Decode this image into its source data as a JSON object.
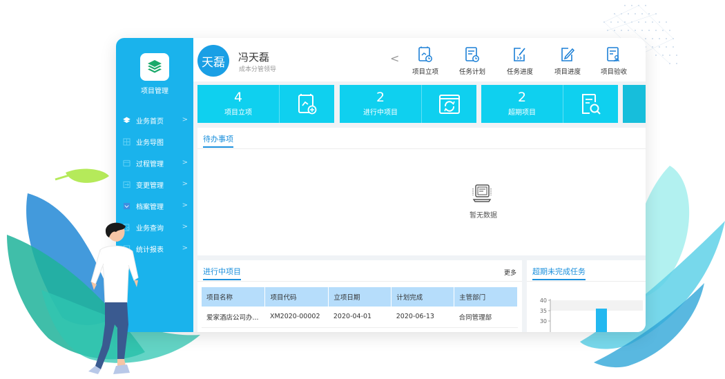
{
  "sidebar": {
    "title": "项目管理",
    "items": [
      {
        "label": "业务首页",
        "icon": "layers-icon"
      },
      {
        "label": "业务导图",
        "icon": "map-icon"
      },
      {
        "label": "过程管理",
        "icon": "process-icon"
      },
      {
        "label": "变更管理",
        "icon": "change-icon"
      },
      {
        "label": "档案管理",
        "icon": "archive-icon"
      },
      {
        "label": "业务查询",
        "icon": "query-icon"
      },
      {
        "label": "统计报表",
        "icon": "report-icon"
      }
    ]
  },
  "user": {
    "avatar_text": "天磊",
    "name": "冯天磊",
    "role": "成本分管领导"
  },
  "quick_actions": [
    {
      "label": "项目立项",
      "icon": "project-setup-icon"
    },
    {
      "label": "任务计划",
      "icon": "task-plan-icon"
    },
    {
      "label": "任务进度",
      "icon": "task-progress-icon"
    },
    {
      "label": "项目进度",
      "icon": "project-progress-icon"
    },
    {
      "label": "项目验收",
      "icon": "project-acceptance-icon"
    }
  ],
  "stats": [
    {
      "value": "4",
      "label": "项目立项",
      "icon": "document-branch-icon"
    },
    {
      "value": "2",
      "label": "进行中项目",
      "icon": "refresh-icon"
    },
    {
      "value": "2",
      "label": "超期项目",
      "icon": "document-search-icon"
    }
  ],
  "todo": {
    "tab": "待办事项",
    "empty_text": "暂无数据"
  },
  "ongoing": {
    "tab": "进行中项目",
    "more": "更多",
    "columns": [
      "项目名称",
      "项目代码",
      "立项日期",
      "计划完成",
      "主管部门"
    ],
    "rows": [
      [
        "爱家酒店公司办...",
        "XM2020-00002",
        "2020-04-01",
        "2020-06-13",
        "合同管理部"
      ]
    ]
  },
  "overdue": {
    "tab": "超期未完成任务"
  },
  "chart_data": {
    "type": "bar",
    "y_ticks": [
      "40",
      "35",
      "30"
    ],
    "ylim": [
      30,
      40
    ],
    "values": [
      36
    ],
    "colors": [
      "#22b8f0"
    ]
  },
  "colors": {
    "sidebar": "#1ab3ec",
    "stat_card": "#0fd0ef",
    "accent": "#1a8fdc",
    "table_header": "#b6ddfb"
  }
}
